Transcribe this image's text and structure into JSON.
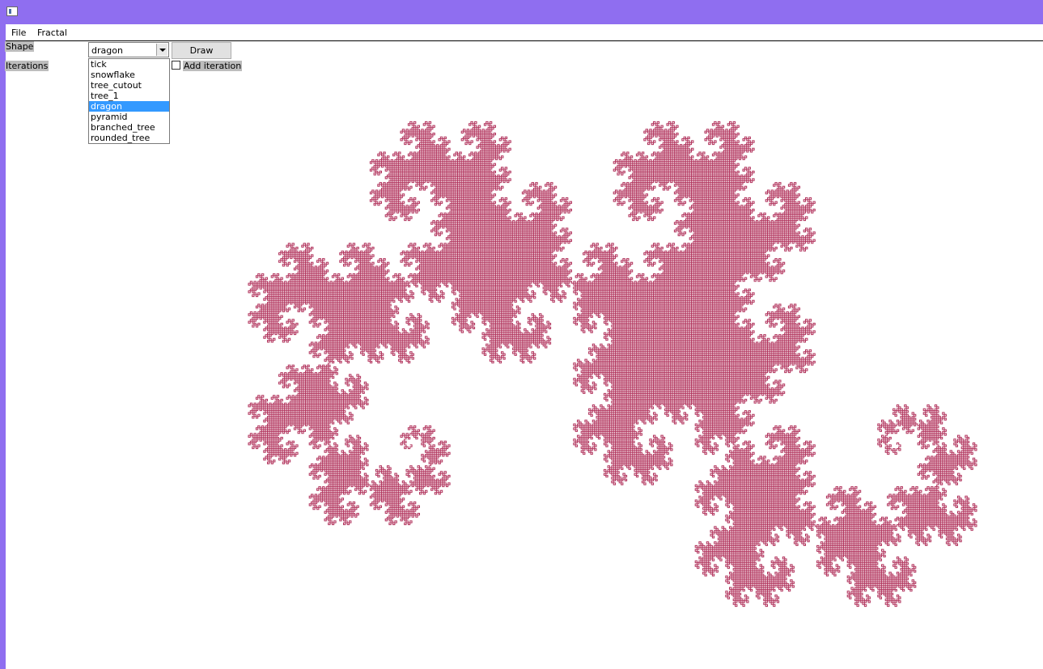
{
  "menu": {
    "file": "File",
    "fractal": "Fractal"
  },
  "controls": {
    "shape_label": "Shape",
    "iterations_label": "Iterations",
    "selected_shape": "dragon",
    "draw_label": "Draw",
    "add_iteration_label": "Add iteration",
    "add_iteration_checked": false
  },
  "shapes": [
    "tick",
    "snowflake",
    "tree_cutout",
    "tree_1",
    "dragon",
    "pyramid",
    "branched_tree",
    "rounded_tree"
  ],
  "highlighted_shape": "dragon",
  "fractal": {
    "type": "dragon",
    "color": "#b0305a",
    "dropdown_highlight": "#3399ff"
  }
}
